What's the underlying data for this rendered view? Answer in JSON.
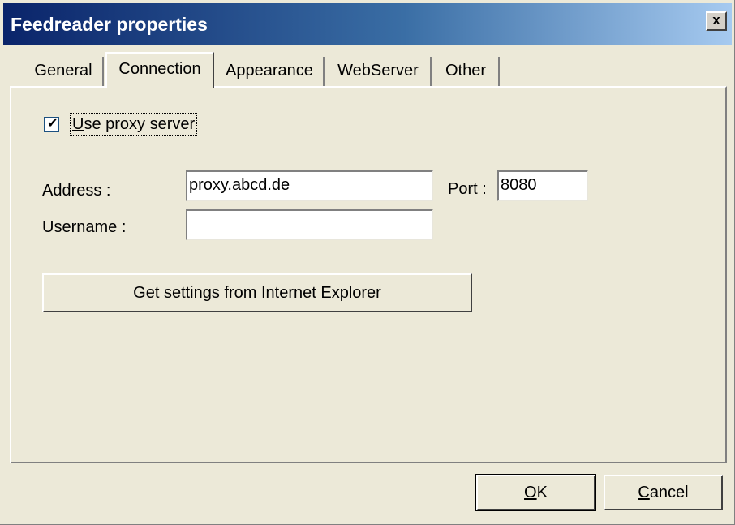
{
  "window": {
    "title": "Feedreader properties",
    "close_label": "x"
  },
  "tabs": [
    {
      "label": "General",
      "active": false
    },
    {
      "label": "Connection",
      "active": true
    },
    {
      "label": "Appearance",
      "active": false
    },
    {
      "label": "WebServer",
      "active": false
    },
    {
      "label": "Other",
      "active": false
    }
  ],
  "connection": {
    "use_proxy": {
      "checked": true,
      "label_mnemonic": "U",
      "label_rest": "se proxy server"
    },
    "address_label": "Address :",
    "address_value": "proxy.abcd.de",
    "port_label": "Port :",
    "port_value": "8080",
    "username_label": "Username :",
    "username_value": "",
    "ie_button_label": "Get settings from Internet Explorer"
  },
  "footer": {
    "ok_mnemonic": "O",
    "ok_rest": "K",
    "cancel_mnemonic": "C",
    "cancel_rest": "ancel"
  }
}
